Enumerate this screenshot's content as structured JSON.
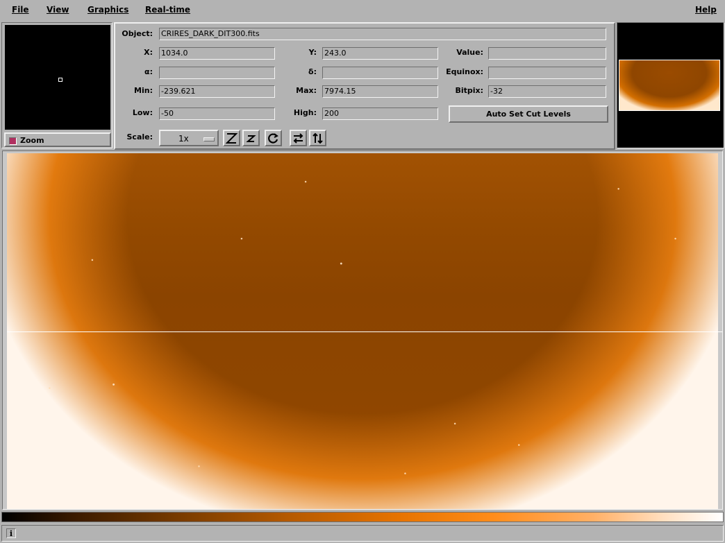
{
  "menu": {
    "file": "File",
    "view": "View",
    "graphics": "Graphics",
    "realtime": "Real-time",
    "help": "Help"
  },
  "zoom": {
    "label": "Zoom"
  },
  "info": {
    "object_label": "Object:",
    "object_value": "CRIRES_DARK_DIT300.fits",
    "x_label": "X:",
    "x_value": "1034.0",
    "y_label": "Y:",
    "y_value": "243.0",
    "value_label": "Value:",
    "value_value": "",
    "alpha_label": "α:",
    "alpha_value": "",
    "delta_label": "δ:",
    "delta_value": "",
    "equinox_label": "Equinox:",
    "equinox_value": "",
    "min_label": "Min:",
    "min_value": "-239.621",
    "max_label": "Max:",
    "max_value": "7974.15",
    "bitpix_label": "Bitpix:",
    "bitpix_value": "-32",
    "low_label": "Low:",
    "low_value": "-50",
    "high_label": "High:",
    "high_value": "200",
    "autoset_label": "Auto Set Cut Levels",
    "scale_label": "Scale:",
    "scale_value": "1x"
  },
  "toolbar_icons": [
    "zoom-out-icon",
    "zoom-in-icon",
    "rotate-icon",
    "flip-x-icon",
    "flip-y-icon"
  ],
  "colors": {
    "background": "#b3b3b3",
    "image_orange": "#8f4600",
    "cut_line": "#ffffff"
  },
  "statusbar": {
    "icon": "info-icon",
    "icon_glyph": "i",
    "message": ""
  }
}
